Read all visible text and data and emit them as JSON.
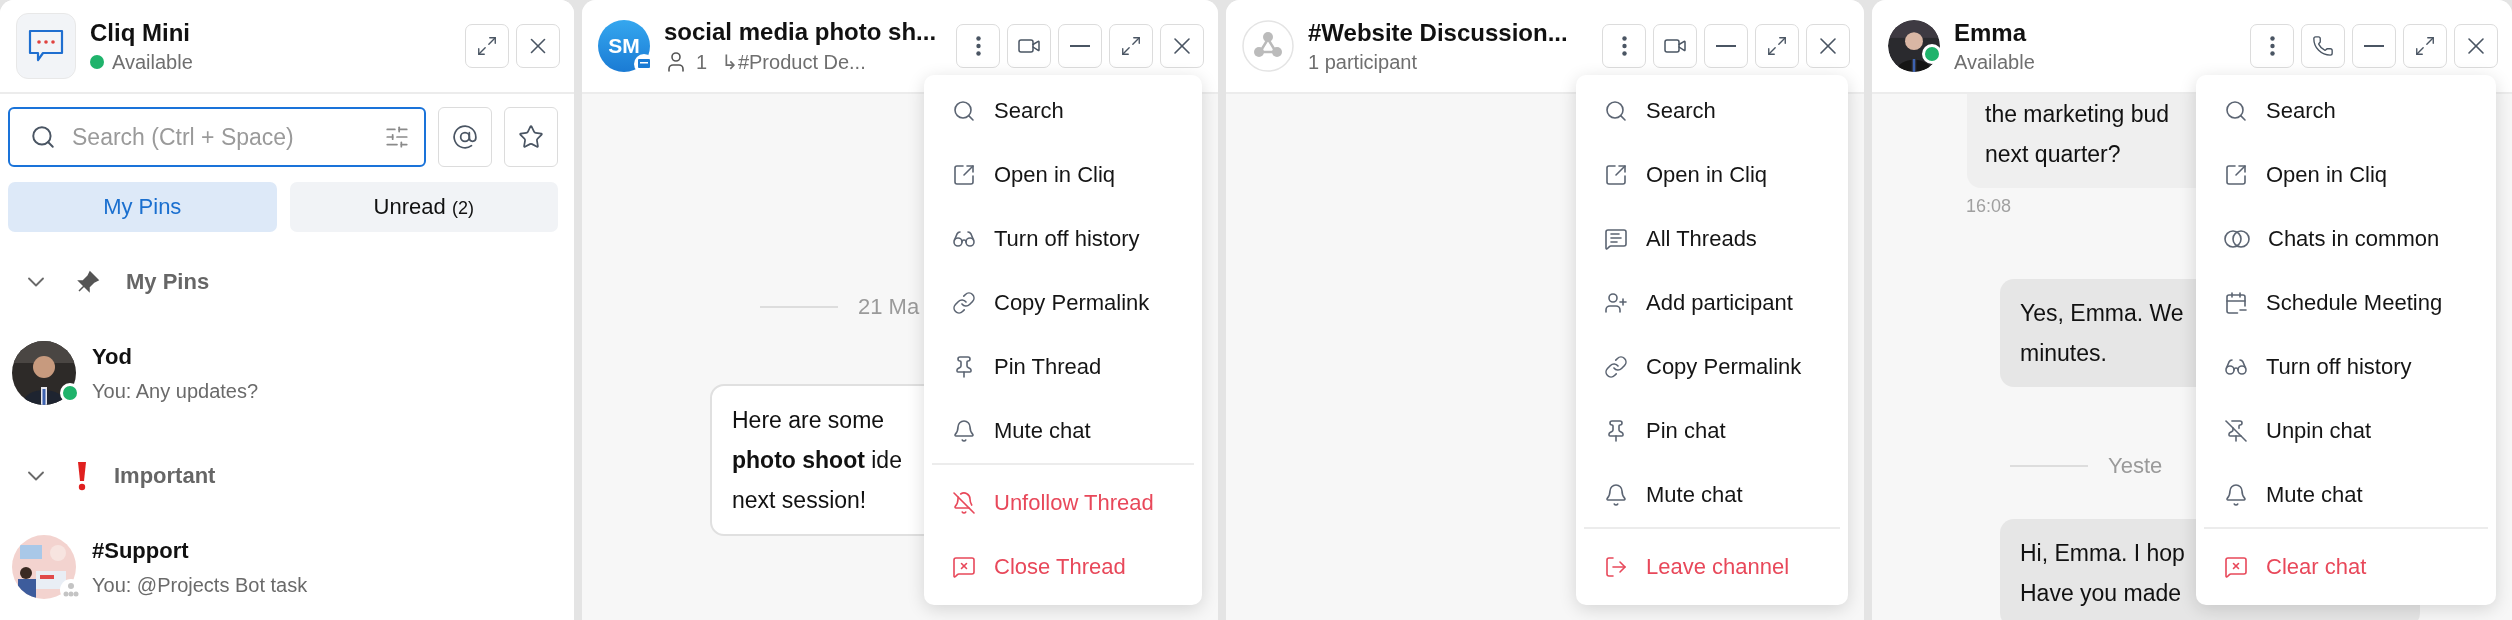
{
  "sidebar": {
    "title": "Cliq Mini",
    "status": "Available",
    "online": true,
    "search": {
      "placeholder": "Search (Ctrl + Space)"
    },
    "tabs": [
      {
        "label": "My Pins",
        "selected": true
      },
      {
        "label": "Unread",
        "count": "(2)",
        "selected": false
      }
    ],
    "sections": [
      {
        "kind": "pinned",
        "title": "My Pins",
        "expanded": true,
        "items": [
          {
            "kind": "contact",
            "name": "Yod",
            "preview": "You: Any updates?",
            "online": true
          }
        ]
      },
      {
        "kind": "important",
        "title": "Important",
        "expanded": true,
        "items": [
          {
            "kind": "channel",
            "name": "#Support",
            "preview": "You: @Projects Bot task",
            "online": false
          }
        ]
      }
    ]
  },
  "chats": [
    {
      "kind": "thread",
      "avatar": "SM",
      "title": "social media photo sh...",
      "members": "1",
      "parent": "↳#Product De...",
      "timeline": [
        {
          "kind": "date",
          "text": "21 Ma"
        },
        {
          "kind": "message",
          "from_me": false,
          "lines": [
            "Here are some",
            "**photo shoot** ide",
            "next session!"
          ]
        }
      ],
      "menu": [
        {
          "items": [
            {
              "kind": "search",
              "label": "Search",
              "danger": false
            },
            {
              "kind": "open",
              "label": "Open in Cliq",
              "danger": false
            },
            {
              "kind": "history",
              "label": "Turn off history",
              "danger": false
            },
            {
              "kind": "link",
              "label": "Copy Permalink",
              "danger": false
            },
            {
              "kind": "pin",
              "label": "Pin Thread",
              "danger": false
            },
            {
              "kind": "mute",
              "label": "Mute chat",
              "danger": false
            }
          ]
        },
        {
          "items": [
            {
              "kind": "unfollow",
              "label": "Unfollow Thread",
              "danger": true
            },
            {
              "kind": "close",
              "label": "Close Thread",
              "danger": true
            }
          ]
        }
      ]
    },
    {
      "kind": "channel",
      "title": "#Website Discussion...",
      "subtitle": "1 participant",
      "menu": [
        {
          "items": [
            {
              "kind": "search",
              "label": "Search",
              "danger": false
            },
            {
              "kind": "open",
              "label": "Open in Cliq",
              "danger": false
            },
            {
              "kind": "threads",
              "label": "All Threads",
              "danger": false
            },
            {
              "kind": "add",
              "label": "Add participant",
              "danger": false
            },
            {
              "kind": "link",
              "label": "Copy Permalink",
              "danger": false
            },
            {
              "kind": "pin",
              "label": "Pin chat",
              "danger": false
            },
            {
              "kind": "mute",
              "label": "Mute chat",
              "danger": false
            }
          ]
        },
        {
          "items": [
            {
              "kind": "leave",
              "label": "Leave channel",
              "danger": true
            }
          ]
        }
      ]
    },
    {
      "kind": "direct",
      "title": "Emma",
      "subtitle": "Available",
      "online": true,
      "timeline": [
        {
          "kind": "message",
          "from_me": false,
          "lines": [
            "the marketing bud",
            "next quarter?"
          ]
        },
        {
          "kind": "time",
          "text": "16:08"
        },
        {
          "kind": "message",
          "from_me": true,
          "lines": [
            "Yes, Emma. We",
            "minutes."
          ]
        },
        {
          "kind": "date",
          "text": "Yeste"
        },
        {
          "kind": "message",
          "from_me": true,
          "lines": [
            "Hi, Emma. I hop",
            "Have you made"
          ]
        }
      ],
      "menu": [
        {
          "items": [
            {
              "kind": "search",
              "label": "Search",
              "danger": false
            },
            {
              "kind": "open",
              "label": "Open in Cliq",
              "danger": false
            },
            {
              "kind": "common",
              "label": "Chats in common",
              "danger": false
            },
            {
              "kind": "meeting",
              "label": "Schedule Meeting",
              "danger": false
            },
            {
              "kind": "history",
              "label": "Turn off history",
              "danger": false
            },
            {
              "kind": "unpin",
              "label": "Unpin chat",
              "danger": false
            },
            {
              "kind": "mute",
              "label": "Mute chat",
              "danger": false
            }
          ]
        },
        {
          "items": [
            {
              "kind": "clear",
              "label": "Clear chat",
              "danger": true
            }
          ]
        }
      ]
    }
  ]
}
